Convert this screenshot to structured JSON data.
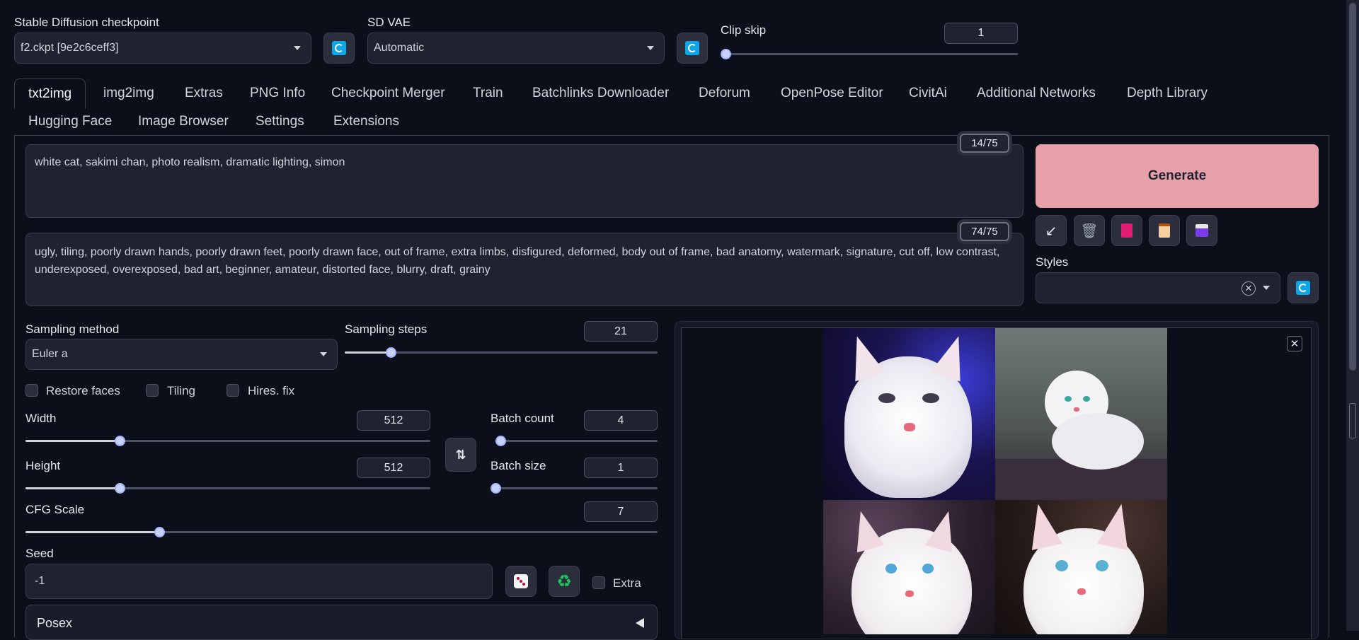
{
  "top": {
    "checkpoint": {
      "label": "Stable Diffusion checkpoint",
      "value": "f2.ckpt [9e2c6ceff3]"
    },
    "vae": {
      "label": "SD VAE",
      "value": "Automatic"
    },
    "clip_skip": {
      "label": "Clip skip",
      "value": "1"
    }
  },
  "tabs": [
    "txt2img",
    "img2img",
    "Extras",
    "PNG Info",
    "Checkpoint Merger",
    "Train",
    "Batchlinks Downloader",
    "Deforum",
    "OpenPose Editor",
    "CivitAi",
    "Additional Networks",
    "Depth Library",
    "Hugging Face",
    "Image Browser",
    "Settings",
    "Extensions"
  ],
  "prompt": {
    "text": "white cat, sakimi chan, photo realism, dramatic lighting, simon",
    "count": "14/75"
  },
  "negative": {
    "text": " ugly, tiling, poorly drawn hands, poorly drawn feet, poorly drawn face, out of frame, extra limbs, disfigured, deformed, body out of frame, bad anatomy, watermark, signature, cut off, low contrast, underexposed, overexposed, bad art, beginner, amateur, distorted face, blurry, draft, grainy",
    "count": "74/75"
  },
  "generate": {
    "label": "Generate"
  },
  "styles": {
    "label": "Styles",
    "value": ""
  },
  "sampling": {
    "method_label": "Sampling method",
    "method": "Euler a",
    "steps_label": "Sampling steps",
    "steps": "21"
  },
  "checks": {
    "restore_faces": "Restore faces",
    "tiling": "Tiling",
    "hires": "Hires. fix",
    "extra": "Extra"
  },
  "width": {
    "label": "Width",
    "value": "512"
  },
  "height": {
    "label": "Height",
    "value": "512"
  },
  "batch_count": {
    "label": "Batch count",
    "value": "4"
  },
  "batch_size": {
    "label": "Batch size",
    "value": "1"
  },
  "cfg": {
    "label": "CFG Scale",
    "value": "7"
  },
  "seed": {
    "label": "Seed",
    "value": "-1"
  },
  "posex": {
    "label": "Posex"
  },
  "icons": {
    "refresh": "refresh-icon",
    "swap": "swap-icon",
    "dice": "dice-icon",
    "recycle": "recycle-icon",
    "close": "close-icon",
    "arrow_in": "arrow-icon",
    "trash": "trash-icon",
    "style_card": "style-card-icon",
    "clipboard": "clipboard-icon",
    "save": "save-icon"
  },
  "colors": {
    "generate_bg": "#e8a0a8",
    "accent": "#0ea5e9"
  }
}
